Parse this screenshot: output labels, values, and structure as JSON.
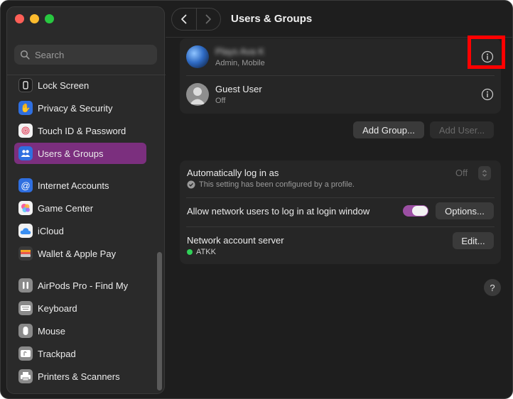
{
  "window": {
    "title": "Users & Groups"
  },
  "sidebar": {
    "search_placeholder": "Search",
    "items": [
      {
        "label": "Lock Screen",
        "icon": "lock-screen-icon",
        "color": "#1c1c1c"
      },
      {
        "label": "Privacy & Security",
        "icon": "hand-icon",
        "color": "#2f6fe0"
      },
      {
        "label": "Touch ID & Password",
        "icon": "fingerprint-icon",
        "color": "#f2f2f2"
      },
      {
        "label": "Users & Groups",
        "icon": "users-icon",
        "color": "#2f6fe0",
        "selected": true
      },
      {
        "label": "Internet Accounts",
        "icon": "at-icon",
        "color": "#2f6fe0"
      },
      {
        "label": "Game Center",
        "icon": "game-center-icon",
        "color": "#f2f2f2"
      },
      {
        "label": "iCloud",
        "icon": "cloud-icon",
        "color": "#f2f2f2"
      },
      {
        "label": "Wallet & Apple Pay",
        "icon": "wallet-icon",
        "color": "#3a3a3a"
      },
      {
        "label": "AirPods Pro - Find My",
        "icon": "airpods-icon",
        "color": "#8a8a8a"
      },
      {
        "label": "Keyboard",
        "icon": "keyboard-icon",
        "color": "#8a8a8a"
      },
      {
        "label": "Mouse",
        "icon": "mouse-icon",
        "color": "#8a8a8a"
      },
      {
        "label": "Trackpad",
        "icon": "trackpad-icon",
        "color": "#8a8a8a"
      },
      {
        "label": "Printers & Scanners",
        "icon": "printer-icon",
        "color": "#8a8a8a"
      }
    ]
  },
  "users": [
    {
      "name": "Plays Ava K",
      "subtitle": "Admin, Mobile"
    },
    {
      "name": "Guest User",
      "subtitle": "Off"
    }
  ],
  "buttons": {
    "add_group": "Add Group...",
    "add_user": "Add User..."
  },
  "settings": {
    "auto_login": {
      "label": "Automatically log in as",
      "value": "Off",
      "note": "This setting has been configured by a profile."
    },
    "network_users": {
      "label": "Allow network users to log in at login window",
      "toggle_on": true,
      "button": "Options..."
    },
    "network_server": {
      "label": "Network account server",
      "status": "ATKK",
      "status_color": "#30d158",
      "button": "Edit..."
    }
  },
  "help_label": "?",
  "accent": "#7b2f7e"
}
